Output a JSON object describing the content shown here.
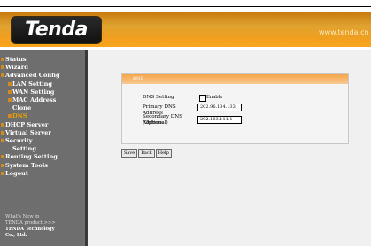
{
  "header": {
    "logo_text": "Tenda",
    "site_url": "www.tenda.cn"
  },
  "sidebar": {
    "items": [
      {
        "label": "Status",
        "type": "top"
      },
      {
        "label": "Wizard",
        "type": "top"
      },
      {
        "label": "Advanced Config",
        "type": "top"
      },
      {
        "label": "LAN Setting",
        "type": "sub"
      },
      {
        "label": "WAN Setting",
        "type": "sub"
      },
      {
        "label": "MAC Address",
        "type": "sub"
      },
      {
        "label": "Clone",
        "type": "cont"
      },
      {
        "label": "DNS",
        "type": "current"
      },
      {
        "label": "DHCP Server",
        "type": "top"
      },
      {
        "label": "Virtual Server",
        "type": "top"
      },
      {
        "label": "Security",
        "type": "top"
      },
      {
        "label": "Setting",
        "type": "cont"
      },
      {
        "label": "Routing Setting",
        "type": "top"
      },
      {
        "label": "System Tools",
        "type": "top"
      },
      {
        "label": "Logout",
        "type": "top"
      }
    ],
    "footer": {
      "line1": "What's New in",
      "line2": "TENDA product >>>",
      "line3": "TENDA Technology",
      "line4": "Co., Ltd."
    }
  },
  "dns_panel": {
    "title": "DNS",
    "dns_setting_label": "DNS Setting",
    "enable_label": "Enable",
    "enable_checked": false,
    "primary_label": "Primary DNS Address",
    "primary_value": "202.96.134.133",
    "secondary_label_line1": "Secondary DNS Address",
    "secondary_label_line2": "(Optional)",
    "secondary_value": "202.103.111.1"
  },
  "buttons": {
    "save": "Save",
    "back": "Back",
    "help": "Help"
  }
}
